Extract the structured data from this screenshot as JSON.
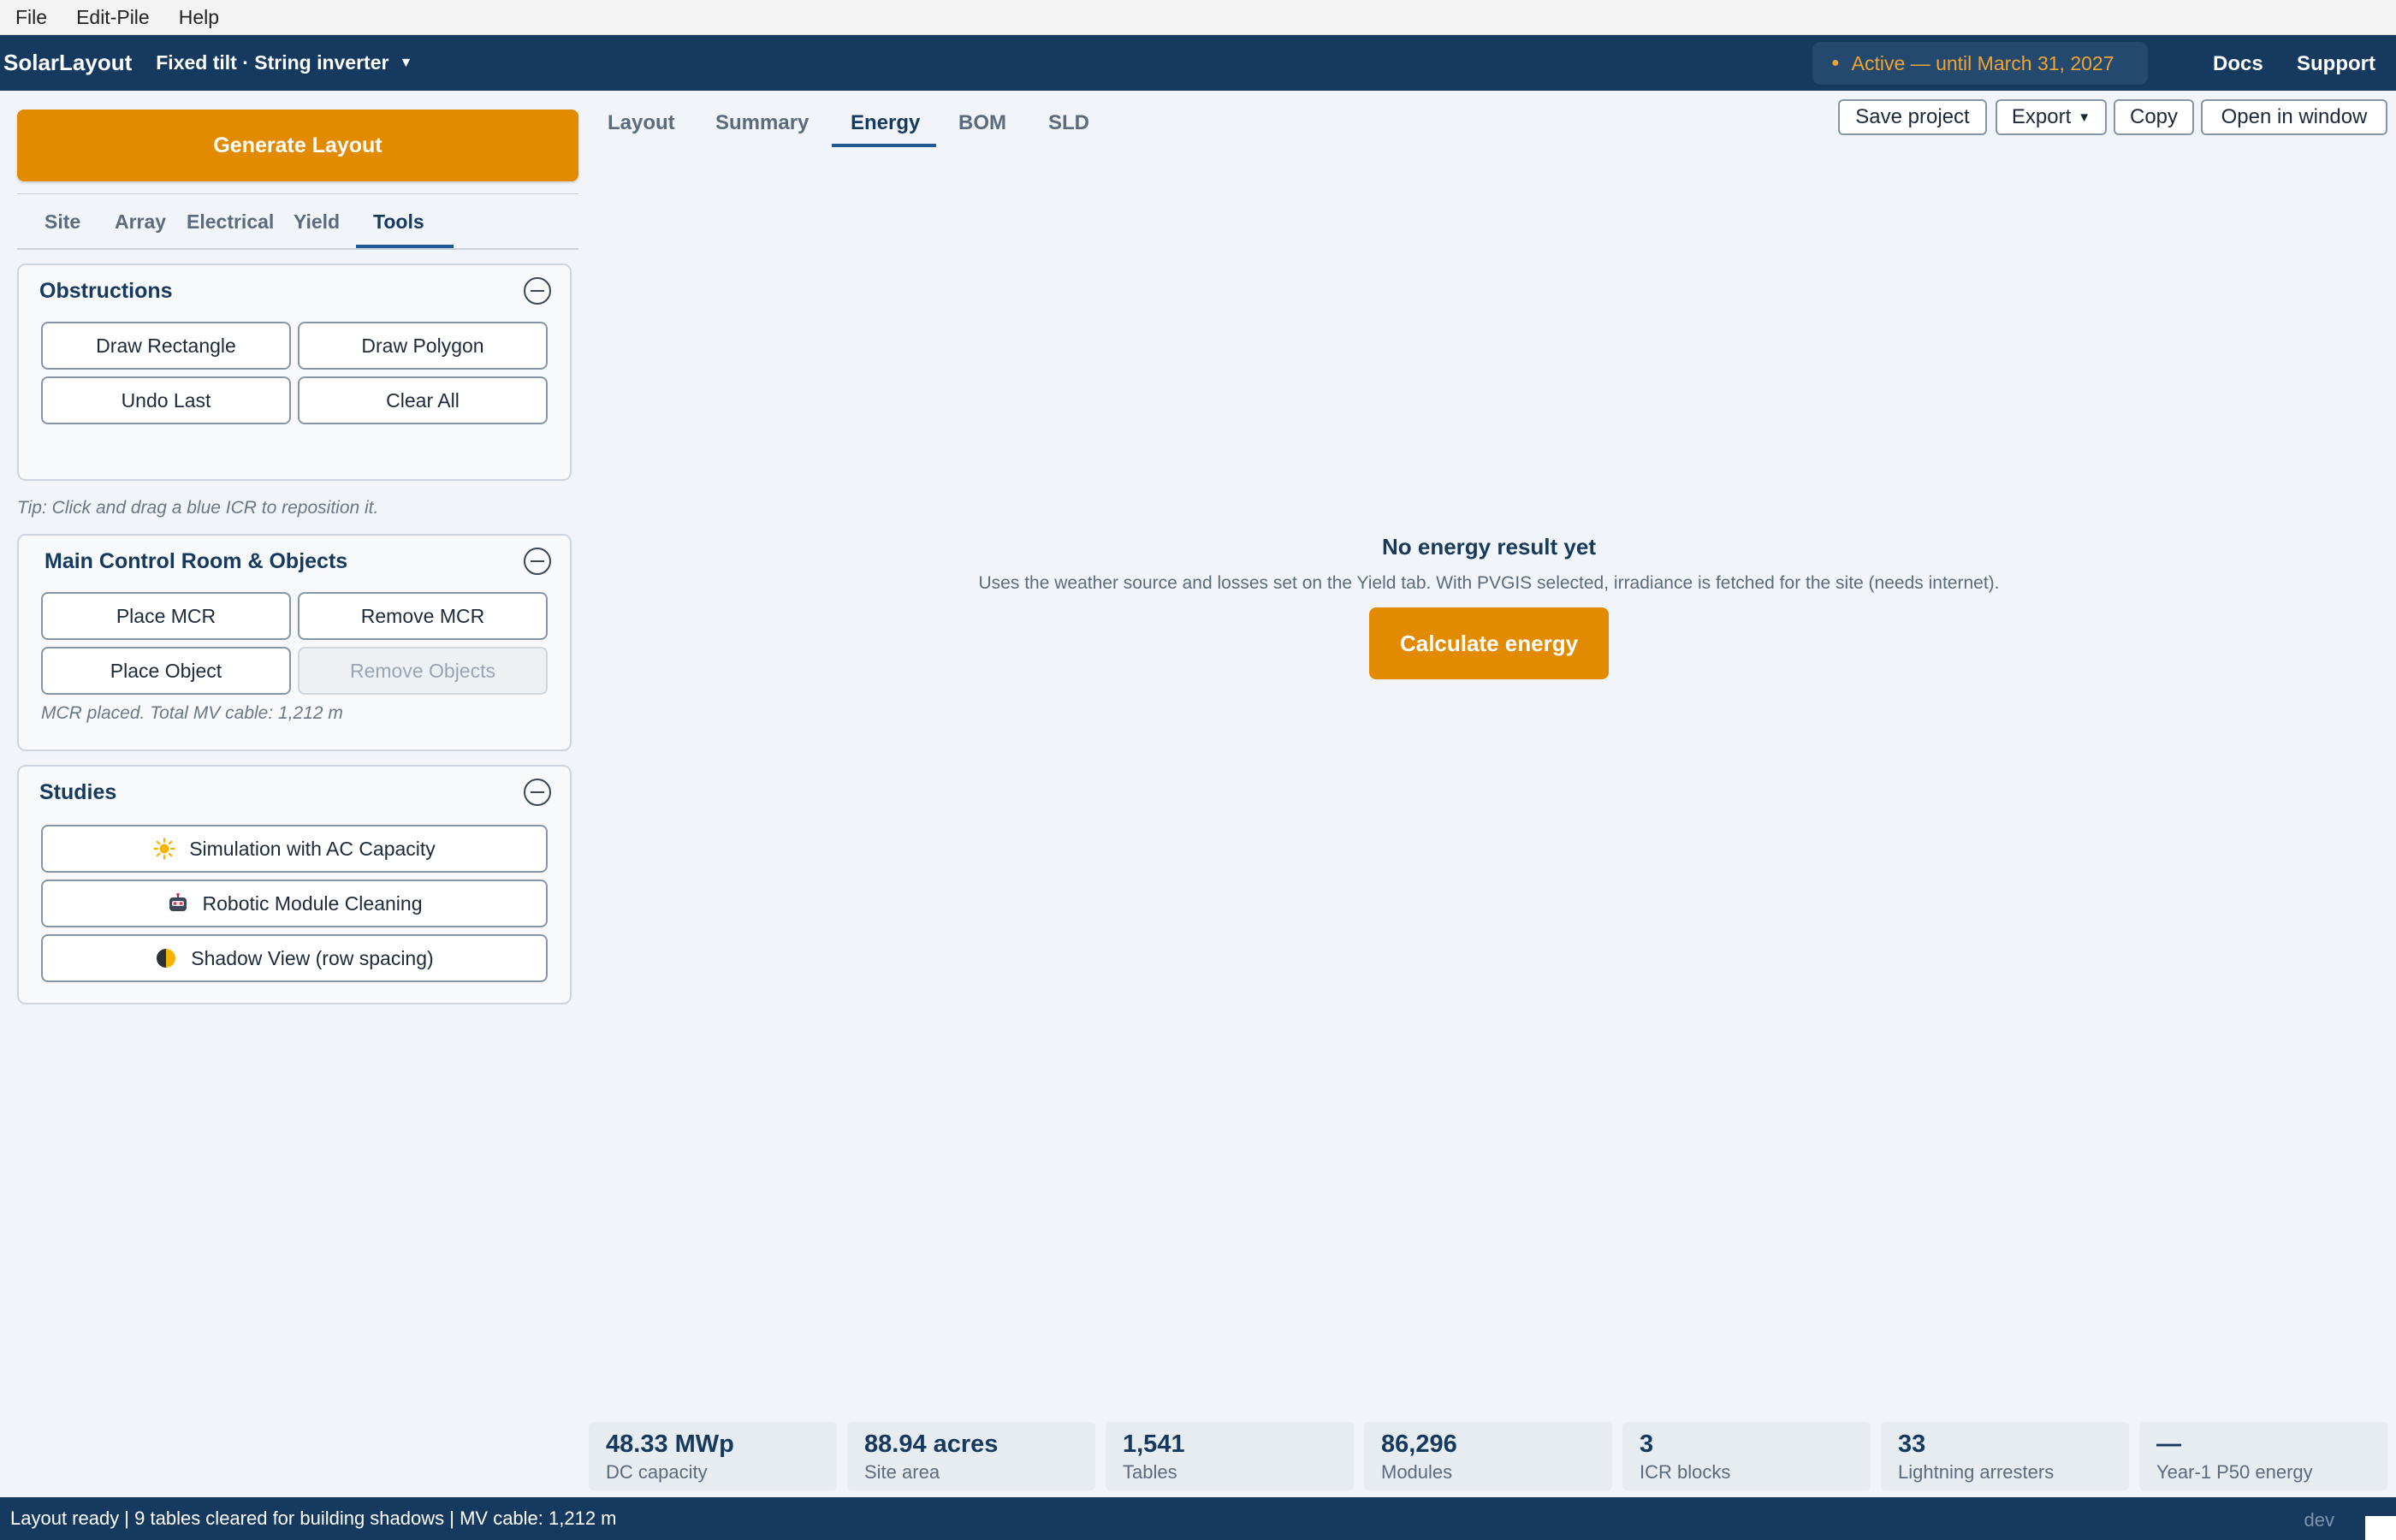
{
  "menu": [
    "File",
    "Edit-Pile",
    "Help"
  ],
  "header": {
    "brand": "SolarLayout",
    "mode": "Fixed tilt · String inverter",
    "license": "Active — until March 31, 2027",
    "docs": "Docs",
    "support": "Support"
  },
  "sidebar": {
    "generate": "Generate Layout",
    "tabs": [
      "Site",
      "Array",
      "Electrical",
      "Yield",
      "Tools"
    ],
    "active_tab": "Tools",
    "obstructions": {
      "title": "Obstructions",
      "buttons": [
        "Draw Rectangle",
        "Draw Polygon",
        "Undo Last",
        "Clear All"
      ]
    },
    "tip": "Tip: Click and drag a blue ICR to reposition it.",
    "mcr": {
      "title": "Main Control Room & Objects",
      "buttons": [
        "Place MCR",
        "Remove MCR",
        "Place Object",
        "Remove Objects"
      ],
      "disabled": "Remove Objects",
      "status": "MCR placed. Total MV cable: 1,212 m"
    },
    "studies": {
      "title": "Studies",
      "buttons": [
        {
          "label": "Simulation with AC Capacity",
          "icon": "sun-icon"
        },
        {
          "label": "Robotic Module Cleaning",
          "icon": "robot-icon"
        },
        {
          "label": "Shadow View (row spacing)",
          "icon": "half-moon-icon"
        }
      ]
    }
  },
  "main": {
    "tabs": [
      "Layout",
      "Summary",
      "Energy",
      "BOM",
      "SLD"
    ],
    "active_tab": "Energy",
    "toolbar": {
      "save": "Save project",
      "export": "Export",
      "copy": "Copy",
      "open": "Open in window"
    },
    "empty": {
      "title": "No energy result yet",
      "subtitle": "Uses the weather source and losses set on the Yield tab. With PVGIS selected, irradiance is fetched for the site (needs internet).",
      "action": "Calculate energy"
    }
  },
  "stats": [
    {
      "value": "48.33 MWp",
      "label": "DC capacity"
    },
    {
      "value": "88.94 acres",
      "label": "Site area"
    },
    {
      "value": "1,541",
      "label": "Tables"
    },
    {
      "value": "86,296",
      "label": "Modules"
    },
    {
      "value": "3",
      "label": "ICR blocks"
    },
    {
      "value": "33",
      "label": "Lightning arresters"
    },
    {
      "value": "—",
      "label": "Year-1 P50 energy"
    }
  ],
  "status": {
    "message": "Layout ready | 9 tables cleared for building shadows | MV cable: 1,212 m",
    "env": "dev"
  },
  "colors": {
    "header": "#163a5f",
    "accent": "#e38b00",
    "license_text": "#f0a431"
  }
}
